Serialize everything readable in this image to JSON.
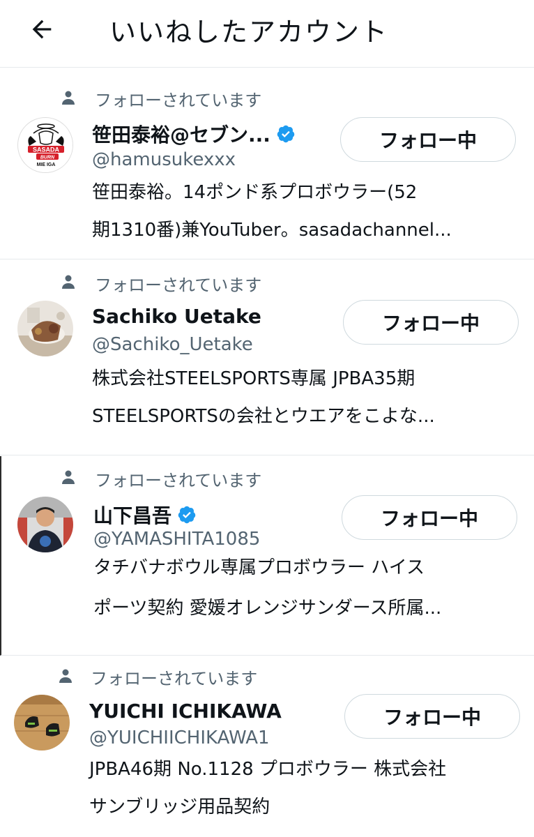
{
  "header": {
    "title": "いいねしたアカウント",
    "back_icon": "arrow-left-icon"
  },
  "colors": {
    "verified": "#1d9bf0",
    "secondary_text": "#536471",
    "primary_text": "#0f1419",
    "divider": "#e6e9ec"
  },
  "users": [
    {
      "follows_you": "フォローされています",
      "name": "笹田泰裕@セブン...",
      "verified": true,
      "handle": "@hamusukexxx",
      "bio_line1": "笹田泰裕。14ポンド系プロボウラー(52",
      "bio_line2": "期1310番)兼YouTuber。sasadachannel...",
      "button_label": "フォロー中",
      "avatar_logo_top": "SASADA CHANNEL",
      "avatar_logo_main": "SASADA",
      "avatar_logo_burn": "BURN",
      "avatar_logo_bottom": "MIE IGA"
    },
    {
      "follows_you": "フォローされています",
      "name": "Sachiko Uetake",
      "verified": false,
      "handle": "@Sachiko_Uetake",
      "bio_line1": "株式会社STEELSPORTS専属 JPBA35期",
      "bio_line2": "STEELSPORTSの会社とウエアをこよな...",
      "button_label": "フォロー中"
    },
    {
      "follows_you": "フォローされています",
      "name": "山下昌吾",
      "verified": true,
      "handle": "@YAMASHITA1085",
      "bio_line1": "タチバナボウル専属プロボウラー ハイス",
      "bio_line2": "ポーツ契約 愛媛オレンジサンダース所属...",
      "button_label": "フォロー中"
    },
    {
      "follows_you": "フォローされています",
      "name": "YUICHI ICHIKAWA",
      "verified": false,
      "handle": "@YUICHIICHIKAWA1",
      "bio_line1": "JPBA46期 No.1128 プロボウラー 株式会社",
      "bio_line2": "サンブリッジ用品契約",
      "button_label": "フォロー中"
    }
  ]
}
